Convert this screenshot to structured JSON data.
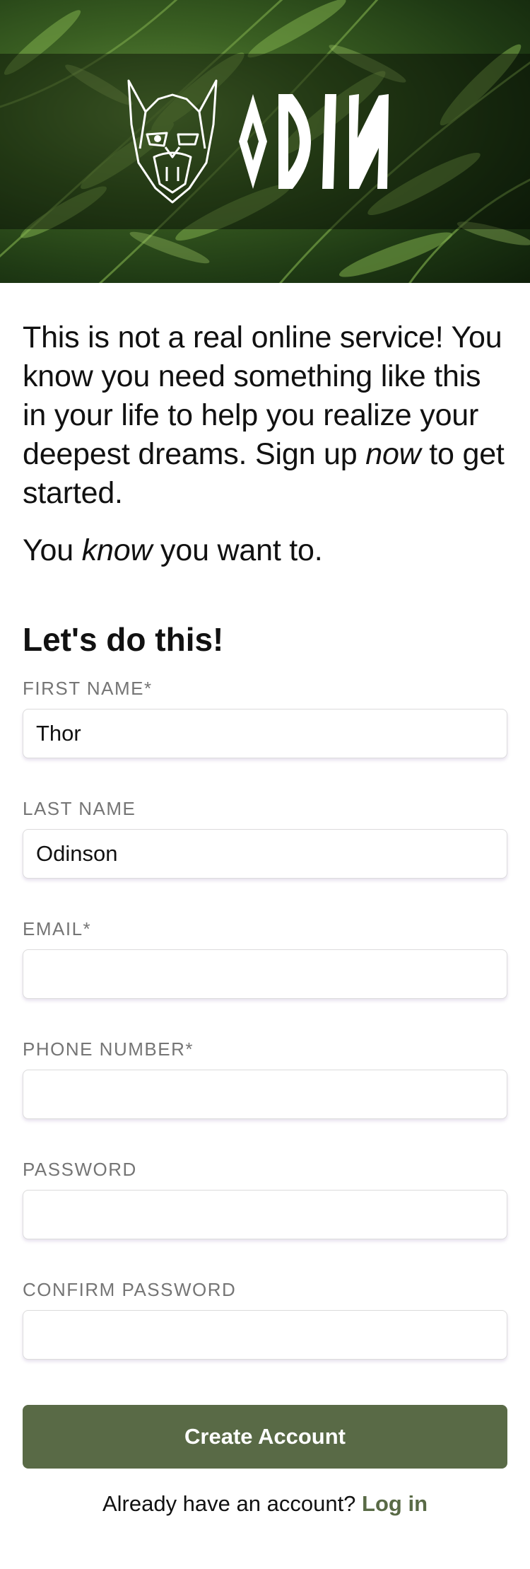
{
  "brand": {
    "name": "ODIN",
    "logo_icon": "viking-head-icon"
  },
  "intro": {
    "line1_before": "This is not a real online service! You know you need something like this in your life to help you realize your deepest dreams. Sign up ",
    "line1_em": "now",
    "line1_after": " to get started.",
    "line2_before": "You ",
    "line2_em": "know",
    "line2_after": " you want to."
  },
  "form": {
    "title": "Let's do this!",
    "fields": [
      {
        "label": "FIRST NAME*",
        "value": "Thor",
        "type": "text"
      },
      {
        "label": "LAST NAME",
        "value": "Odinson",
        "type": "text"
      },
      {
        "label": "EMAIL*",
        "value": "",
        "type": "email"
      },
      {
        "label": "PHONE NUMBER*",
        "value": "",
        "type": "tel"
      },
      {
        "label": "PASSWORD",
        "value": "",
        "type": "password"
      },
      {
        "label": "CONFIRM PASSWORD",
        "value": "",
        "type": "password"
      }
    ],
    "submit_label": "Create Account",
    "login_prompt": "Already have an account?",
    "login_link": "Log in"
  },
  "colors": {
    "accent": "#596a46",
    "label": "#757575"
  }
}
